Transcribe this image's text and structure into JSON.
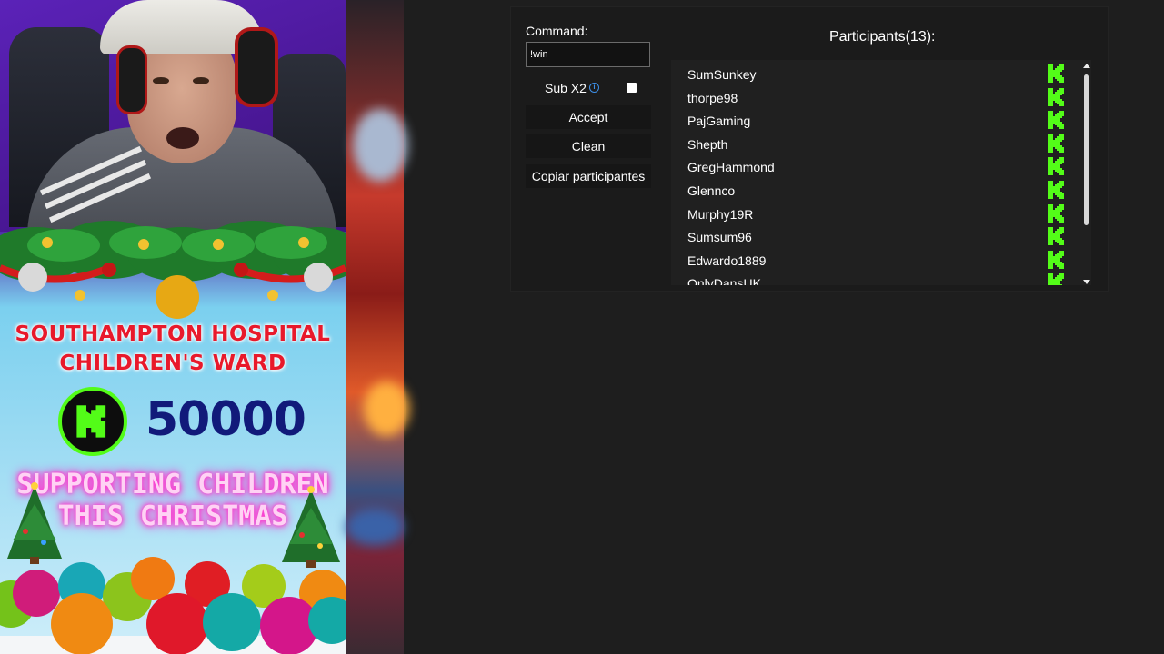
{
  "stream_overlay": {
    "charity_line1": "SOUTHAMPTON HOSPITAL",
    "charity_line2": "CHILDREN'S WARD",
    "goal_amount": "50000",
    "support_line1": "SUPPORTING CHILDREN",
    "support_line2": "THIS CHRISTMAS",
    "kick_logo_icon": "kick-logo-icon"
  },
  "panel": {
    "command_label": "Command:",
    "command_value": "!win",
    "subx2_label": "Sub X2",
    "subx2_checked": false,
    "info_icon": "info-icon",
    "accept_label": "Accept",
    "clean_label": "Clean",
    "copy_label": "Copiar participantes",
    "participants_title": "Participants(13):",
    "participants": [
      {
        "name": "SumSunkey",
        "platform_icon": "kick-icon"
      },
      {
        "name": "thorpe98",
        "platform_icon": "kick-icon"
      },
      {
        "name": "PajGaming",
        "platform_icon": "kick-icon"
      },
      {
        "name": "Shepth",
        "platform_icon": "kick-icon"
      },
      {
        "name": "GregHammond",
        "platform_icon": "kick-icon"
      },
      {
        "name": "Glennco",
        "platform_icon": "kick-icon"
      },
      {
        "name": "Murphy19R",
        "platform_icon": "kick-icon"
      },
      {
        "name": "Sumsum96",
        "platform_icon": "kick-icon"
      },
      {
        "name": "Edwardo1889",
        "platform_icon": "kick-icon"
      },
      {
        "name": "OnlyDansUK",
        "platform_icon": "kick-icon"
      }
    ]
  },
  "colors": {
    "kick_green": "#53fc18",
    "panel_bg": "#1b1b1b",
    "page_bg": "#1e1e1e",
    "charity_red": "#e8192b",
    "goal_navy": "#111a7a",
    "neon_pink": "#ff3ccf"
  }
}
